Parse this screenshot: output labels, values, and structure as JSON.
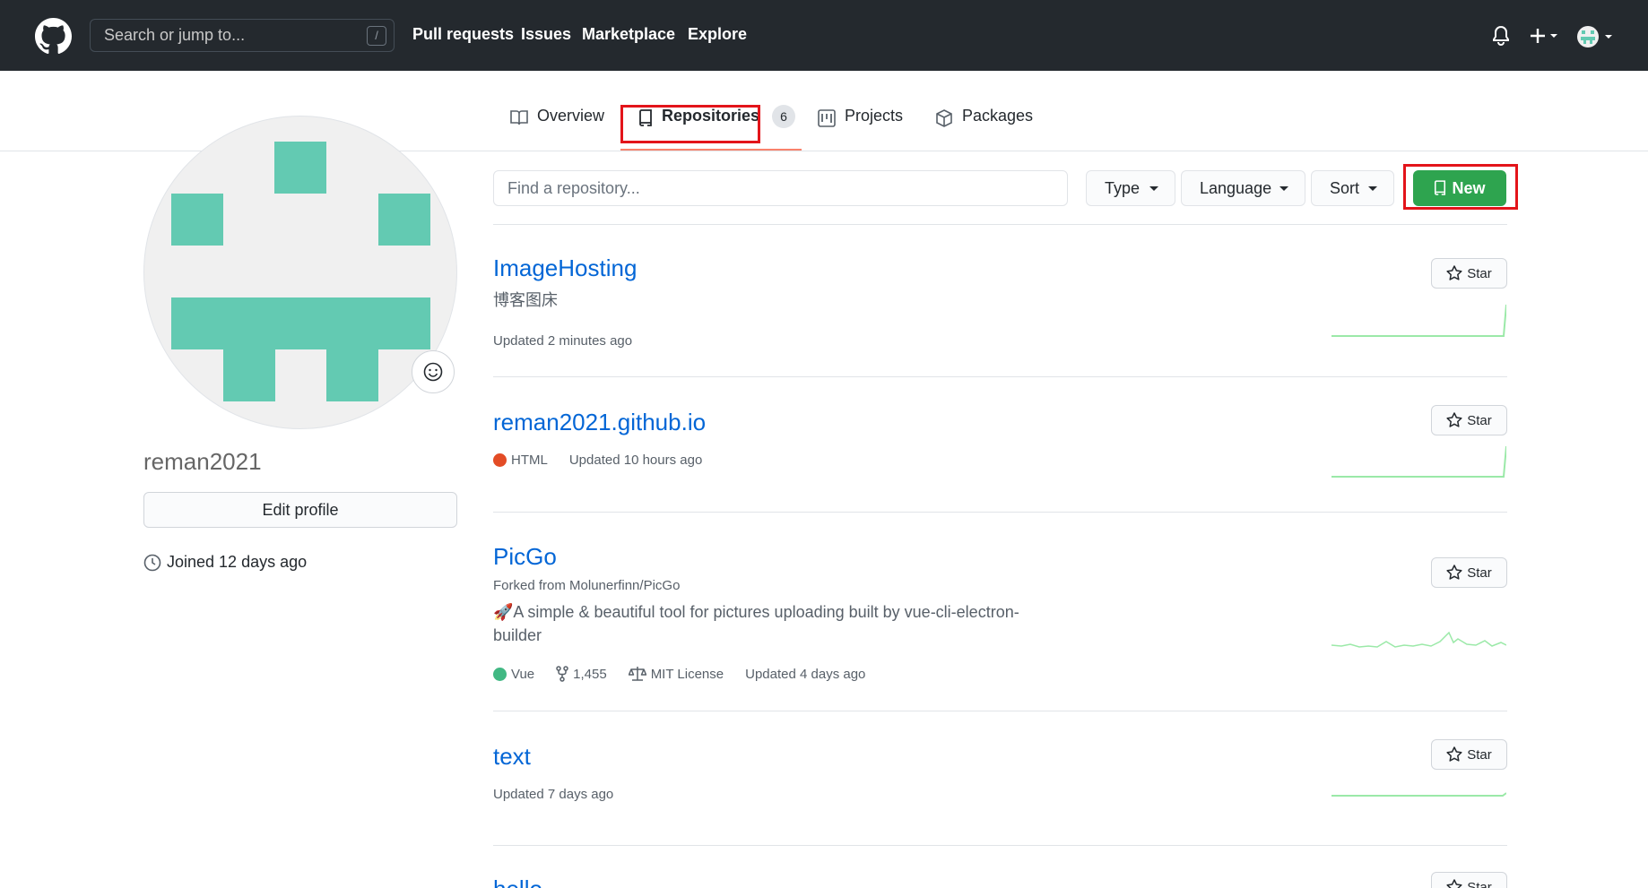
{
  "header": {
    "search_placeholder": "Search or jump to...",
    "search_shortcut": "/",
    "nav": [
      "Pull requests",
      "Issues",
      "Marketplace",
      "Explore"
    ]
  },
  "tabs": {
    "overview": "Overview",
    "repositories": "Repositories",
    "repositories_count": "6",
    "projects": "Projects",
    "packages": "Packages"
  },
  "profile": {
    "username": "reman2021",
    "edit_label": "Edit profile",
    "joined": "Joined 12 days ago"
  },
  "toolbar": {
    "find_placeholder": "Find a repository...",
    "type_label": "Type",
    "language_label": "Language",
    "sort_label": "Sort",
    "new_label": "New"
  },
  "star_label": "Star",
  "repos": [
    {
      "name": "ImageHosting",
      "description": "博客图床",
      "updated": "Updated 2 minutes ago"
    },
    {
      "name": "reman2021.github.io",
      "language": "HTML",
      "language_color": "#e34c26",
      "updated": "Updated 10 hours ago"
    },
    {
      "name": "PicGo",
      "forked_from": "Forked from Molunerfinn/PicGo",
      "description": "🚀A simple & beautiful tool for pictures uploading built by vue-cli-electron-builder",
      "language": "Vue",
      "language_color": "#41b883",
      "forks": "1,455",
      "license": "MIT License",
      "updated": "Updated 4 days ago"
    },
    {
      "name": "text",
      "updated": "Updated 7 days ago"
    },
    {
      "name": "hello"
    }
  ],
  "colors": {
    "header_bg": "#24292e",
    "link": "#0366d6",
    "new_button": "#2ea44f",
    "highlight": "#e3141a",
    "tab_underline": "#f9826c"
  }
}
